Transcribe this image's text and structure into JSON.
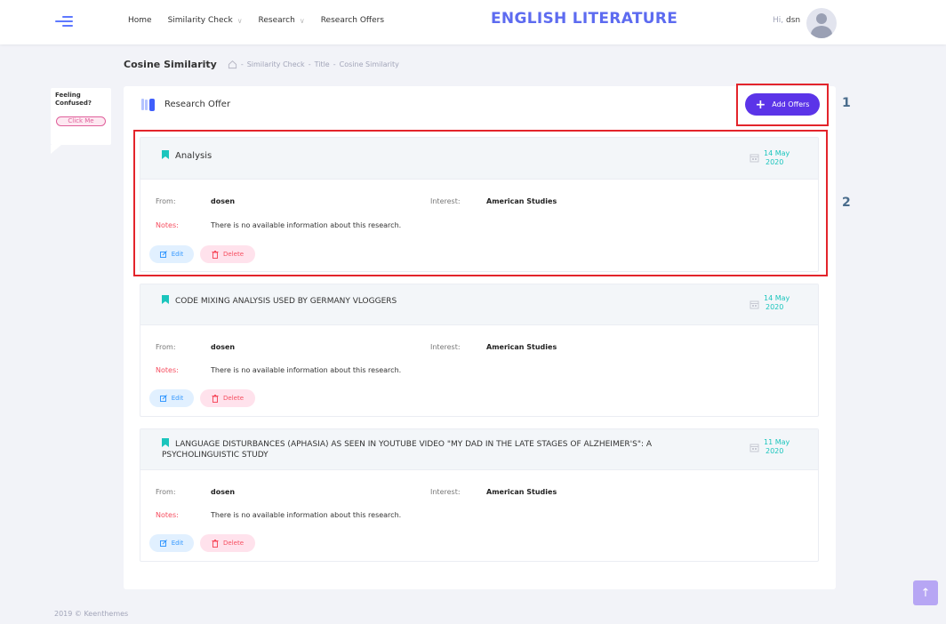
{
  "header": {
    "nav": [
      {
        "label": "Home",
        "dropdown": false
      },
      {
        "label": "Similarity Check",
        "dropdown": true
      },
      {
        "label": "Research",
        "dropdown": true
      },
      {
        "label": "Research Offers",
        "dropdown": false
      }
    ],
    "brand": "ENGLISH LITERATURE",
    "greeting_prefix": "Hi,",
    "username": "dsn"
  },
  "subheader": {
    "title": "Cosine Similarity",
    "breadcrumb": [
      "Similarity Check",
      "Title",
      "Cosine Similarity"
    ],
    "separator": "-"
  },
  "help": {
    "text": "Feeling Confused?",
    "button": "Click Me"
  },
  "card": {
    "title": "Research Offer",
    "add_button": "Add Offers"
  },
  "offers": [
    {
      "title": "Analysis",
      "date_line1": "14 May",
      "date_line2": "2020",
      "from_label": "From:",
      "from": "dosen",
      "interest_label": "Interest:",
      "interest": "American Studies",
      "notes_label": "Notes:",
      "notes": "There is no available information about this research.",
      "edit": "Edit",
      "delete": "Delete"
    },
    {
      "title": "CODE MIXING ANALYSIS USED BY GERMANY VLOGGERS",
      "date_line1": "14 May",
      "date_line2": "2020",
      "from_label": "From:",
      "from": "dosen",
      "interest_label": "Interest:",
      "interest": "American Studies",
      "notes_label": "Notes:",
      "notes": "There is no available information about this research.",
      "edit": "Edit",
      "delete": "Delete"
    },
    {
      "title": "LANGUAGE DISTURBANCES (APHASIA) AS SEEN IN YOUTUBE VIDEO \"MY DAD IN THE LATE STAGES OF ALZHEIMER'S\": A PSYCHOLINGUISTIC STUDY",
      "date_line1": "11 May",
      "date_line2": "2020",
      "from_label": "From:",
      "from": "dosen",
      "interest_label": "Interest:",
      "interest": "American Studies",
      "notes_label": "Notes:",
      "notes": "There is no available information about this research.",
      "edit": "Edit",
      "delete": "Delete"
    }
  ],
  "annotations": [
    "1",
    "2"
  ],
  "footer": "2019 © Keenthemes",
  "scroll_top_icon": "arrow-up-icon",
  "colors": {
    "accent": "#5b34e8",
    "brand": "#5d6bf0",
    "success": "#1bc5bd",
    "danger": "#f64e60",
    "highlight": "#e3242b"
  }
}
